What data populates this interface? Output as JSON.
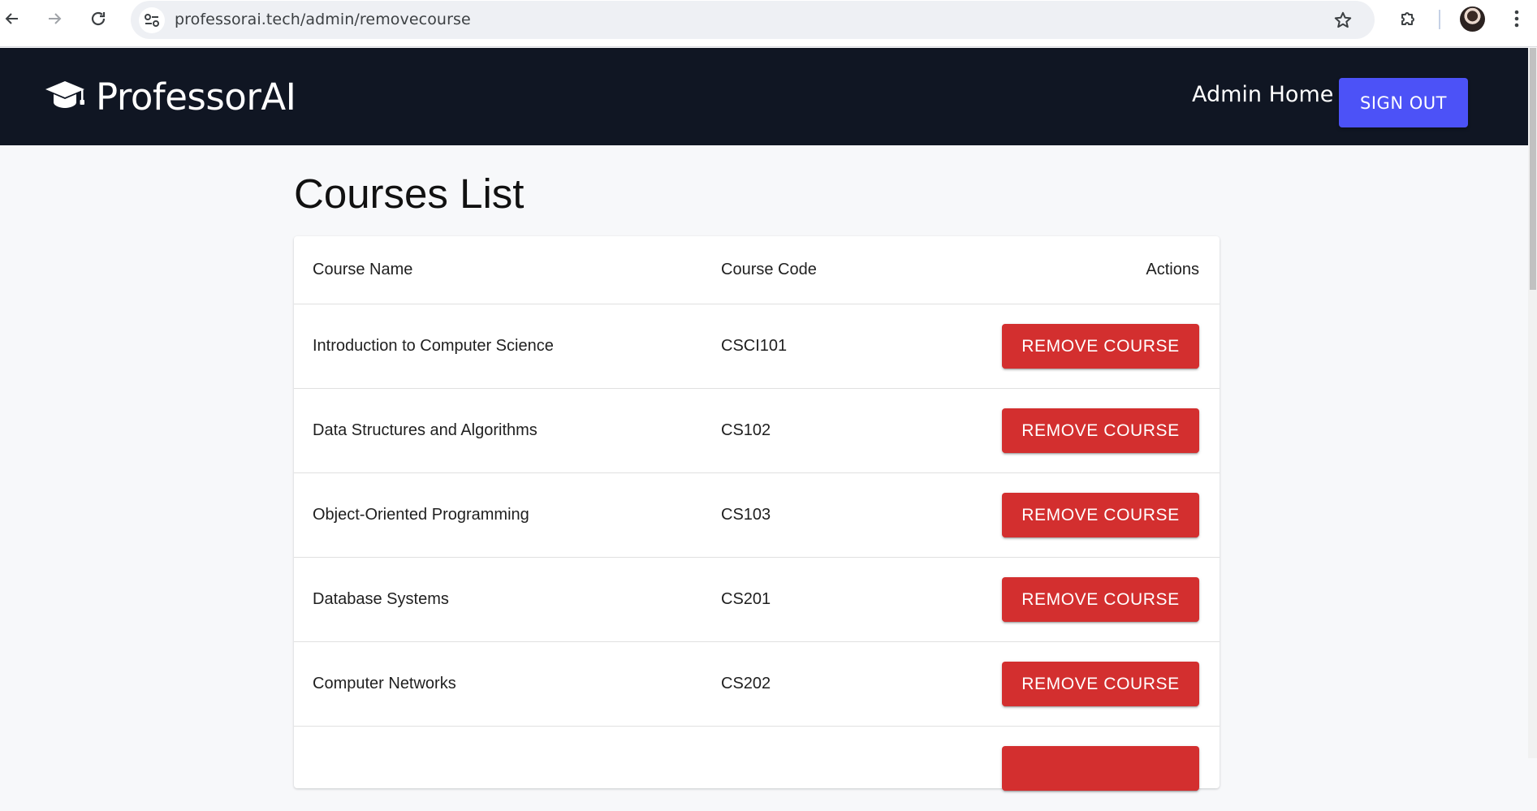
{
  "browser": {
    "url": "professorai.tech/admin/removecourse"
  },
  "header": {
    "brand": "ProfessorAI",
    "nav_admin_home": "Admin Home",
    "sign_out_label": "SIGN OUT"
  },
  "main": {
    "title": "Courses List",
    "columns": {
      "name": "Course Name",
      "code": "Course Code",
      "actions": "Actions"
    },
    "courses": [
      {
        "name": "Introduction to Computer Science",
        "code": "CSCI101",
        "action": "REMOVE COURSE"
      },
      {
        "name": "Data Structures and Algorithms",
        "code": "CS102",
        "action": "REMOVE COURSE"
      },
      {
        "name": "Object-Oriented Programming",
        "code": "CS103",
        "action": "REMOVE COURSE"
      },
      {
        "name": "Database Systems",
        "code": "CS201",
        "action": "REMOVE COURSE"
      },
      {
        "name": "Computer Networks",
        "code": "CS202",
        "action": "REMOVE COURSE"
      },
      {
        "name": "",
        "code": "",
        "action": ""
      }
    ]
  },
  "colors": {
    "header_bg": "#101623",
    "sign_out_bg": "#4c52f7",
    "remove_btn_bg": "#d32f2f",
    "page_bg": "#f7f8fa"
  }
}
